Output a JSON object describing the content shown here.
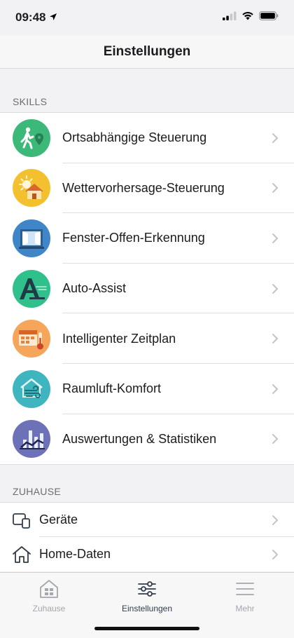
{
  "status": {
    "time": "09:48"
  },
  "header": {
    "title": "Einstellungen"
  },
  "skills_section": {
    "title": "SKILLS",
    "items": [
      {
        "label": "Ortsabhängige Steuerung",
        "icon": "geofencing-walker-icon",
        "color": "#3cb878"
      },
      {
        "label": "Wettervorhersage-Steuerung",
        "icon": "weather-sun-house-icon",
        "color": "#f3c12f"
      },
      {
        "label": "Fenster-Offen-Erkennung",
        "icon": "open-window-icon",
        "color": "#3f86c8"
      },
      {
        "label": "Auto-Assist",
        "icon": "auto-assist-a-icon",
        "color": "#2fc08c"
      },
      {
        "label": "Intelligenter Zeitplan",
        "icon": "calendar-thermometer-icon",
        "color": "#f5a65a"
      },
      {
        "label": "Raumluft-Komfort",
        "icon": "air-comfort-house-icon",
        "color": "#3fb6bf"
      },
      {
        "label": "Auswertungen & Statistiken",
        "icon": "statistics-chart-icon",
        "color": "#6d72b8"
      }
    ]
  },
  "home_section": {
    "title": "ZUHAUSE",
    "items": [
      {
        "label": "Geräte",
        "icon": "devices-icon"
      },
      {
        "label": "Home-Daten",
        "icon": "house-outline-icon"
      }
    ]
  },
  "tabbar": {
    "tabs": [
      {
        "label": "Zuhause",
        "icon": "house-grid-icon",
        "active": false
      },
      {
        "label": "Einstellungen",
        "icon": "sliders-icon",
        "active": true
      },
      {
        "label": "Mehr",
        "icon": "hamburger-menu-icon",
        "active": false
      }
    ]
  },
  "colors": {
    "accent_dark": "#2f3d4c",
    "inactive": "#a4a7ad",
    "chevron": "#c4c4c8"
  }
}
